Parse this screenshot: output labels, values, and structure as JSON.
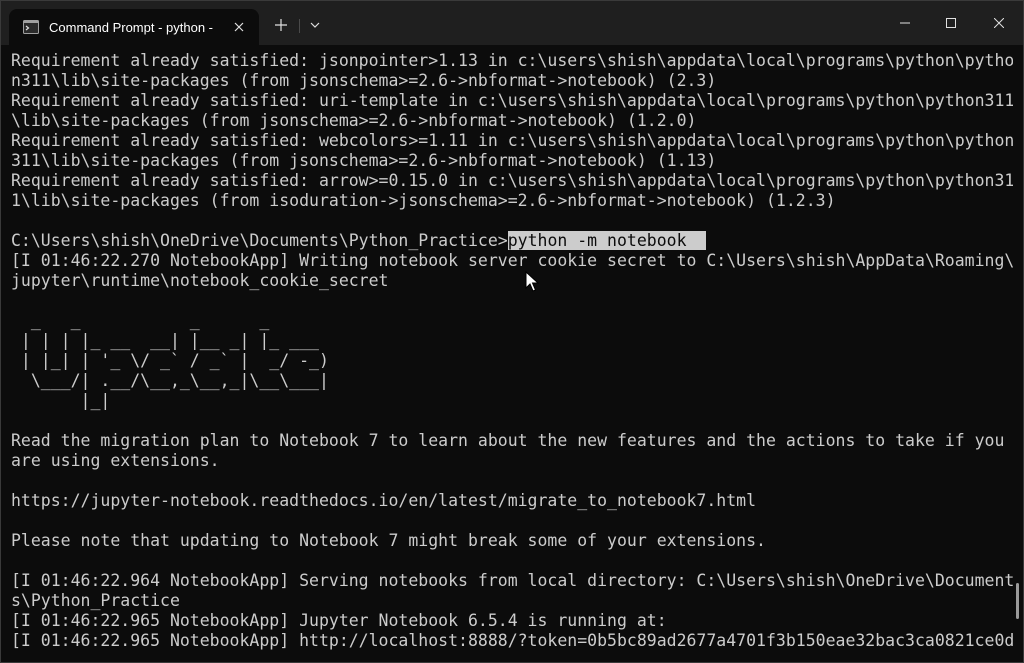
{
  "window": {
    "tab_title": "Command Prompt - python -",
    "icons": {
      "tab": "terminal-icon",
      "tab_close": "close-icon",
      "new_tab": "plus-icon",
      "dropdown": "chevron-down-icon",
      "minimize": "minimize-icon",
      "maximize": "maximize-icon",
      "close": "close-icon"
    }
  },
  "colors": {
    "background": "#0c0c0c",
    "text": "#cccccc",
    "selection": "#cccccc",
    "titlebar": "#1f1f1f"
  },
  "terminal": {
    "lines": [
      "Requirement already satisfied: jsonpointer>1.13 in c:\\users\\shish\\appdata\\local\\programs\\python\\pytho",
      "n311\\lib\\site-packages (from jsonschema>=2.6->nbformat->notebook) (2.3)",
      "Requirement already satisfied: uri-template in c:\\users\\shish\\appdata\\local\\programs\\python\\python311",
      "\\lib\\site-packages (from jsonschema>=2.6->nbformat->notebook) (1.2.0)",
      "Requirement already satisfied: webcolors>=1.11 in c:\\users\\shish\\appdata\\local\\programs\\python\\python",
      "311\\lib\\site-packages (from jsonschema>=2.6->nbformat->notebook) (1.13)",
      "Requirement already satisfied: arrow>=0.15.0 in c:\\users\\shish\\appdata\\local\\programs\\python\\python31",
      "1\\lib\\site-packages (from isoduration->jsonschema>=2.6->nbformat->notebook) (1.2.3)",
      "",
      "",
      "[I 01:46:22.270 NotebookApp] Writing notebook server cookie secret to C:\\Users\\shish\\AppData\\Roaming\\",
      "jupyter\\runtime\\notebook_cookie_secret",
      "",
      "  _   _           _      _",
      " | | | |_ __  __| |__ _| |_ ___",
      " | |_| | '_ \\/ _` / _` |  _/ -_)",
      "  \\___/| .__/\\__,_\\__,_|\\__\\___|",
      "       |_|",
      "",
      "Read the migration plan to Notebook 7 to learn about the new features and the actions to take if you",
      "are using extensions.",
      "",
      "https://jupyter-notebook.readthedocs.io/en/latest/migrate_to_notebook7.html",
      "",
      "Please note that updating to Notebook 7 might break some of your extensions.",
      "",
      "[I 01:46:22.964 NotebookApp] Serving notebooks from local directory: C:\\Users\\shish\\OneDrive\\Document",
      "s\\Python_Practice",
      "[I 01:46:22.965 NotebookApp] Jupyter Notebook 6.5.4 is running at:",
      "[I 01:46:22.965 NotebookApp] http://localhost:8888/?token=0b5bc89ad2677a4701f3b150eae32bac3ca0821ce0d"
    ],
    "prompt": "C:\\Users\\shish\\OneDrive\\Documents\\Python_Practice>",
    "command": "python -m notebook  "
  }
}
